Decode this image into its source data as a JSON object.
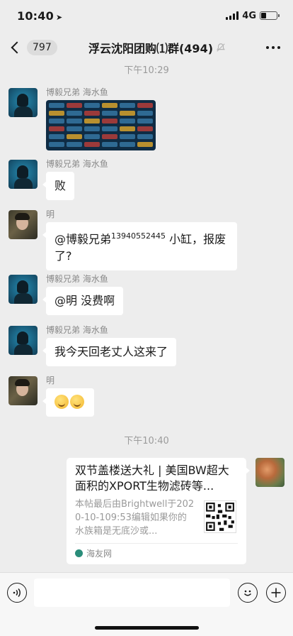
{
  "status_bar": {
    "time": "10:40",
    "network": "4G"
  },
  "nav": {
    "unread_count": "797",
    "title": "浮云沈阳团购⑴群(494)"
  },
  "messages": {
    "time1": "下午10:29",
    "m1": {
      "sender": "博毅兄弟 海水鱼"
    },
    "m2": {
      "sender": "博毅兄弟 海水鱼",
      "text": "败"
    },
    "m3": {
      "sender": "明",
      "mention": "@博毅兄弟",
      "sup": "13940552445",
      "text_line1_tail": " 小缸，报废",
      "text_line2": "了?"
    },
    "m4": {
      "sender": "博毅兄弟 海水鱼",
      "text": "@明 没费啊"
    },
    "m5": {
      "sender": "博毅兄弟 海水鱼",
      "text": "我今天回老丈人这来了"
    },
    "m6": {
      "sender": "明"
    },
    "time2": "下午10:40"
  },
  "link_card": {
    "title": "双节盖楼送大礼 | 美国BW超大面积的XPORT生物滤砖等...",
    "description": "本帖最后由Brightwell于2020-10-109:53编辑如果你的水族箱是无底沙或...",
    "source": "海友网"
  },
  "colors": {
    "chat_background": "#ededed",
    "bubble": "#ffffff",
    "time_text": "#9b9b9b"
  }
}
